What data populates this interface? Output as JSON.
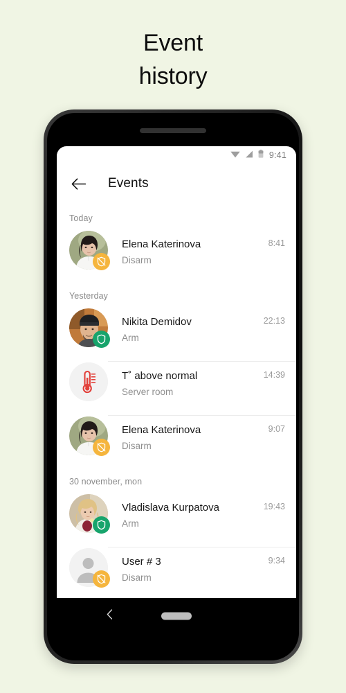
{
  "page": {
    "title_line1": "Event",
    "title_line2": "history",
    "background_color": "#f0f5e4"
  },
  "phone": {
    "status_bar": {
      "time": "9:41",
      "icons": [
        "wifi-icon",
        "signal-icon",
        "battery-icon"
      ]
    },
    "nav_bar": {
      "back_icon": "nav-back-icon",
      "home_pill": "home-indicator"
    }
  },
  "appbar": {
    "back_icon": "back-arrow-icon",
    "title": "Events"
  },
  "colors": {
    "arm_badge": "#17a46c",
    "disarm_badge": "#f5b53d",
    "thermometer": "#e2403a"
  },
  "sections": [
    {
      "header": "Today",
      "events": [
        {
          "title": "Elena Katerinova",
          "subtitle": "Disarm",
          "time": "8:41",
          "badge": "disarm",
          "avatar": "photo-elena",
          "divider": false
        }
      ]
    },
    {
      "header": "Yesterday",
      "events": [
        {
          "title": "Nikita Demidov",
          "subtitle": "Arm",
          "time": "22:13",
          "badge": "arm",
          "avatar": "photo-nikita",
          "divider": false
        },
        {
          "title": "T˚ above normal",
          "subtitle": "Server room",
          "time": "14:39",
          "badge": "none",
          "avatar": "thermometer-icon",
          "divider": true
        },
        {
          "title": "Elena Katerinova",
          "subtitle": "Disarm",
          "time": "9:07",
          "badge": "disarm",
          "avatar": "photo-elena",
          "divider": true
        }
      ]
    },
    {
      "header": "30 november, mon",
      "events": [
        {
          "title": "Vladislava Kurpatova",
          "subtitle": "Arm",
          "time": "19:43",
          "badge": "arm",
          "avatar": "photo-vladislava",
          "divider": false
        },
        {
          "title": "User # 3",
          "subtitle": "Disarm",
          "time": "9:34",
          "badge": "disarm",
          "avatar": "person-placeholder-icon",
          "divider": true
        }
      ]
    }
  ]
}
